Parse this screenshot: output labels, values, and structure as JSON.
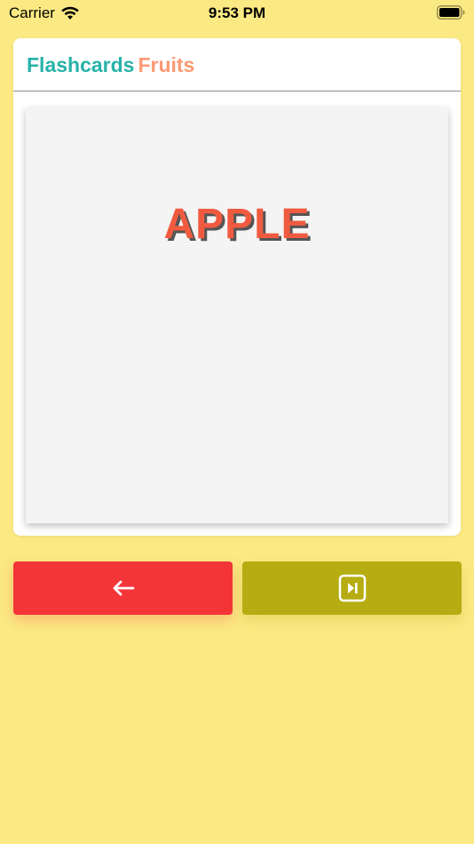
{
  "status_bar": {
    "carrier": "Carrier",
    "time": "9:53 PM",
    "icons": [
      "wifi-icon",
      "battery-icon"
    ]
  },
  "header": {
    "title": "Flashcards",
    "category": "Fruits"
  },
  "card": {
    "word": "APPLE"
  },
  "controls": {
    "back_icon": "arrow-left-icon",
    "next_icon": "skip-forward-icon"
  },
  "colors": {
    "background": "#fbe983",
    "title": "#27b2a8",
    "category": "#fb9a73",
    "word": "#f05b40",
    "word_shadow": "#555555",
    "back_button": "#f33538",
    "next_button": "#b5ad12"
  }
}
